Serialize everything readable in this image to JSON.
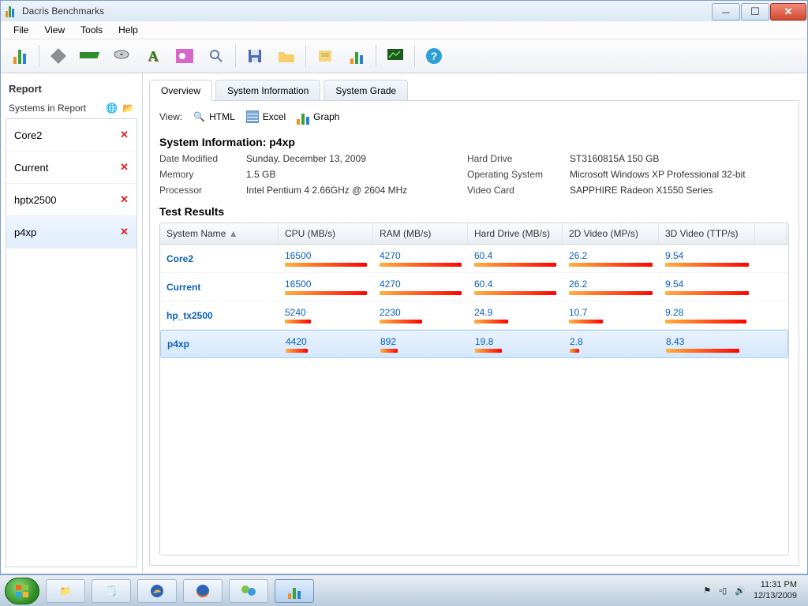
{
  "app": {
    "title": "Dacris Benchmarks"
  },
  "menu": [
    "File",
    "View",
    "Tools",
    "Help"
  ],
  "sidebar": {
    "title": "Report",
    "section": "Systems in Report",
    "items": [
      {
        "name": "Core2"
      },
      {
        "name": "Current"
      },
      {
        "name": "hptx2500"
      },
      {
        "name": "p4xp"
      }
    ]
  },
  "tabs": [
    "Overview",
    "System Information",
    "System Grade"
  ],
  "view": {
    "label": "View:",
    "html": "HTML",
    "excel": "Excel",
    "graph": "Graph"
  },
  "sysinfo": {
    "heading": "System Information: p4xp",
    "date_k": "Date Modified",
    "date_v": "Sunday, December 13, 2009",
    "mem_k": "Memory",
    "mem_v": "1.5 GB",
    "proc_k": "Processor",
    "proc_v": "Intel Pentium 4 2.66GHz @ 2604 MHz",
    "hd_k": "Hard Drive",
    "hd_v": "ST3160815A 150 GB",
    "os_k": "Operating System",
    "os_v": "Microsoft Windows XP Professional 32-bit",
    "vid_k": "Video Card",
    "vid_v": "SAPPHIRE Radeon X1550 Series"
  },
  "results": {
    "heading": "Test Results",
    "cols": [
      "System Name",
      "CPU (MB/s)",
      "RAM (MB/s)",
      "Hard Drive (MB/s)",
      "2D Video (MP/s)",
      "3D Video (TTP/s)"
    ],
    "rows": [
      {
        "name": "Core2",
        "cpu": "16500",
        "ram": "4270",
        "hd": "60.4",
        "v2d": "26.2",
        "v3d": "9.54",
        "b": {
          "cpu": 100,
          "ram": 100,
          "hd": 100,
          "v2d": 100,
          "v3d": 100
        }
      },
      {
        "name": "Current",
        "cpu": "16500",
        "ram": "4270",
        "hd": "60.4",
        "v2d": "26.2",
        "v3d": "9.54",
        "b": {
          "cpu": 100,
          "ram": 100,
          "hd": 100,
          "v2d": 100,
          "v3d": 100
        }
      },
      {
        "name": "hp_tx2500",
        "cpu": "5240",
        "ram": "2230",
        "hd": "24.9",
        "v2d": "10.7",
        "v3d": "9.28",
        "b": {
          "cpu": 32,
          "ram": 52,
          "hd": 41,
          "v2d": 41,
          "v3d": 97
        }
      },
      {
        "name": "p4xp",
        "cpu": "4420",
        "ram": "892",
        "hd": "19.8",
        "v2d": "2.8",
        "v3d": "8.43",
        "b": {
          "cpu": 27,
          "ram": 21,
          "hd": 33,
          "v2d": 11,
          "v3d": 88
        }
      }
    ],
    "selected": 3
  },
  "tray": {
    "time": "11:31 PM",
    "date": "12/13/2009"
  },
  "chart_data": {
    "type": "bar",
    "title": "Test Results",
    "categories": [
      "Core2",
      "Current",
      "hp_tx2500",
      "p4xp"
    ],
    "series": [
      {
        "name": "CPU (MB/s)",
        "values": [
          16500,
          16500,
          5240,
          4420
        ]
      },
      {
        "name": "RAM (MB/s)",
        "values": [
          4270,
          4270,
          2230,
          892
        ]
      },
      {
        "name": "Hard Drive (MB/s)",
        "values": [
          60.4,
          60.4,
          24.9,
          19.8
        ]
      },
      {
        "name": "2D Video (MP/s)",
        "values": [
          26.2,
          26.2,
          10.7,
          2.8
        ]
      },
      {
        "name": "3D Video (TTP/s)",
        "values": [
          9.54,
          9.54,
          9.28,
          8.43
        ]
      }
    ]
  }
}
